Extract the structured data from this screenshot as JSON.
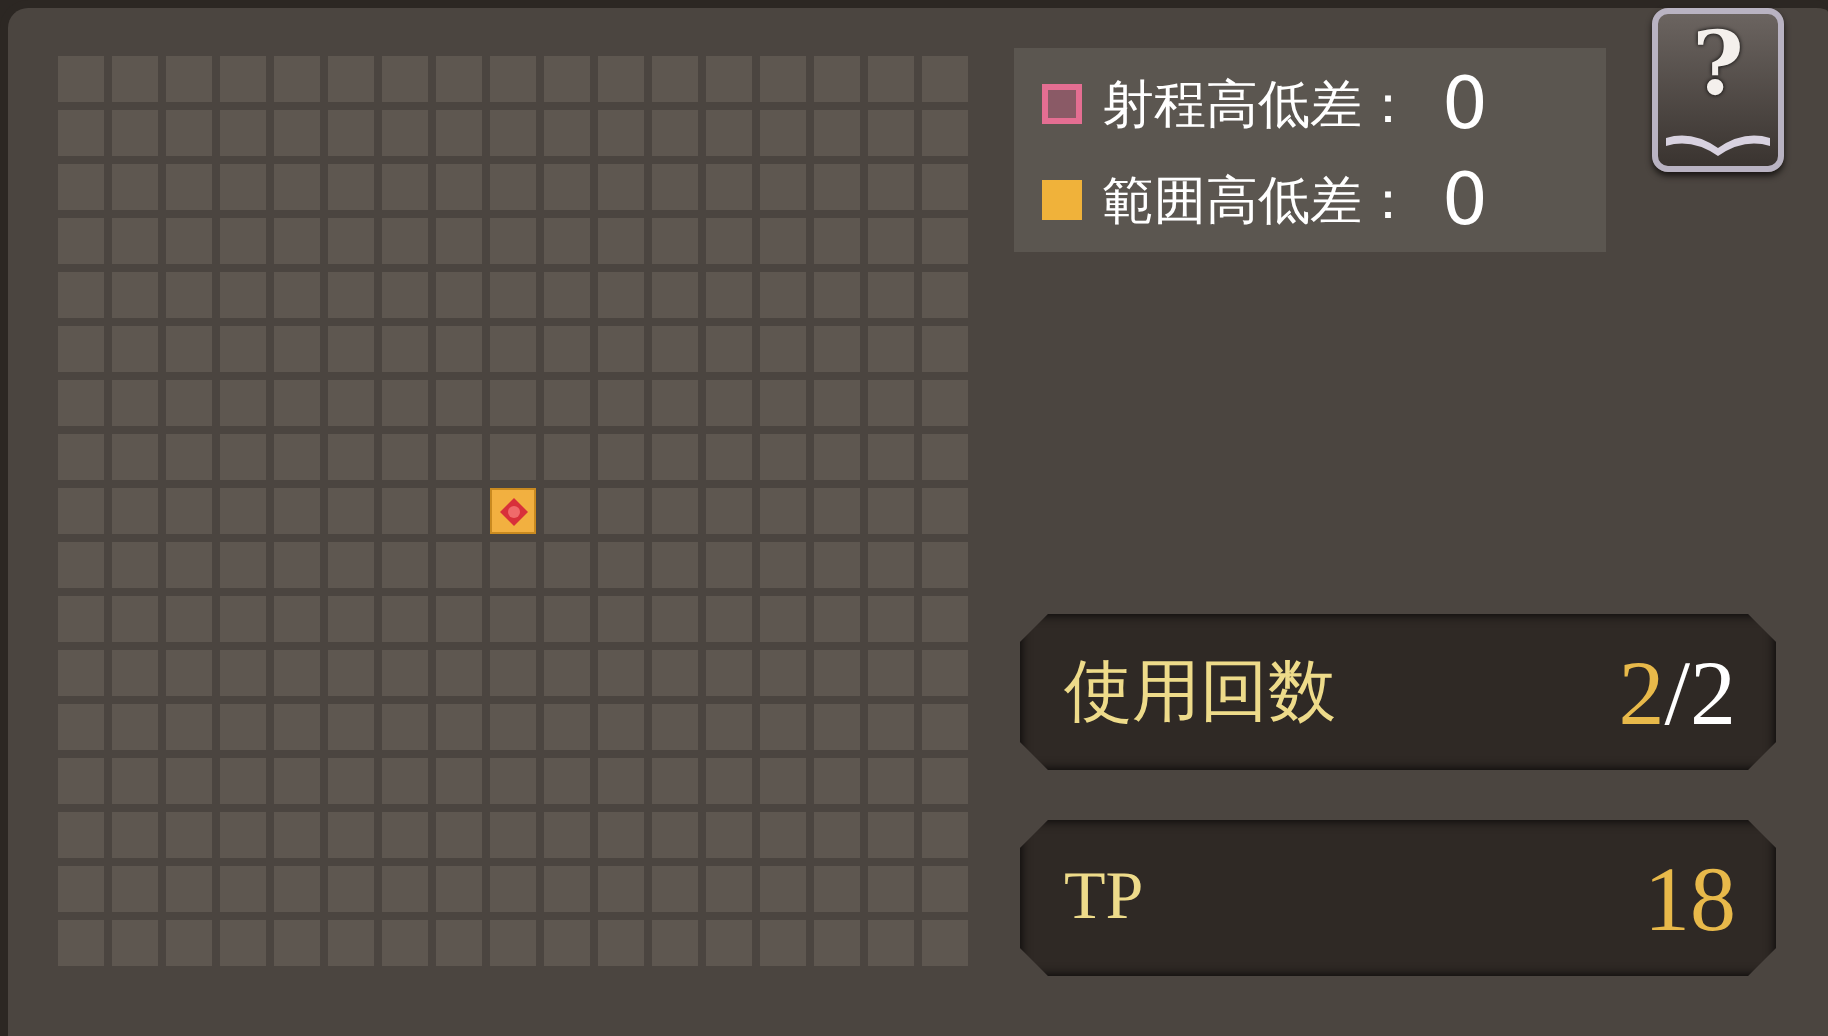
{
  "grid": {
    "rows": [
      [
        {
          "kind": "empty"
        },
        {
          "kind": "empty"
        },
        {
          "kind": "empty"
        },
        {
          "kind": "empty"
        },
        {
          "kind": "empty"
        },
        {
          "kind": "empty"
        },
        {
          "kind": "empty"
        },
        {
          "kind": "empty"
        },
        {
          "kind": "empty"
        },
        {
          "kind": "empty"
        },
        {
          "kind": "empty"
        },
        {
          "kind": "empty"
        },
        {
          "kind": "empty"
        },
        {
          "kind": "empty"
        },
        {
          "kind": "empty"
        },
        {
          "kind": "empty"
        },
        {
          "kind": "empty"
        }
      ],
      [
        {
          "kind": "empty"
        },
        {
          "kind": "empty"
        },
        {
          "kind": "empty"
        },
        {
          "kind": "empty"
        },
        {
          "kind": "empty"
        },
        {
          "kind": "empty"
        },
        {
          "kind": "empty"
        },
        {
          "kind": "empty"
        },
        {
          "kind": "empty"
        },
        {
          "kind": "empty"
        },
        {
          "kind": "empty"
        },
        {
          "kind": "empty"
        },
        {
          "kind": "empty"
        },
        {
          "kind": "empty"
        },
        {
          "kind": "empty"
        },
        {
          "kind": "empty"
        },
        {
          "kind": "empty"
        }
      ],
      [
        {
          "kind": "empty"
        },
        {
          "kind": "empty"
        },
        {
          "kind": "empty"
        },
        {
          "kind": "empty"
        },
        {
          "kind": "empty"
        },
        {
          "kind": "empty"
        },
        {
          "kind": "empty"
        },
        {
          "kind": "empty"
        },
        {
          "kind": "empty"
        },
        {
          "kind": "empty"
        },
        {
          "kind": "empty"
        },
        {
          "kind": "empty"
        },
        {
          "kind": "empty"
        },
        {
          "kind": "empty"
        },
        {
          "kind": "empty"
        },
        {
          "kind": "empty"
        },
        {
          "kind": "empty"
        }
      ],
      [
        {
          "kind": "empty"
        },
        {
          "kind": "empty"
        },
        {
          "kind": "empty"
        },
        {
          "kind": "empty"
        },
        {
          "kind": "empty"
        },
        {
          "kind": "empty"
        },
        {
          "kind": "empty"
        },
        {
          "kind": "empty"
        },
        {
          "kind": "empty"
        },
        {
          "kind": "empty"
        },
        {
          "kind": "empty"
        },
        {
          "kind": "empty"
        },
        {
          "kind": "empty"
        },
        {
          "kind": "empty"
        },
        {
          "kind": "empty"
        },
        {
          "kind": "empty"
        },
        {
          "kind": "empty"
        }
      ],
      [
        {
          "kind": "empty"
        },
        {
          "kind": "empty"
        },
        {
          "kind": "empty"
        },
        {
          "kind": "empty"
        },
        {
          "kind": "empty"
        },
        {
          "kind": "empty"
        },
        {
          "kind": "empty"
        },
        {
          "kind": "empty"
        },
        {
          "kind": "empty"
        },
        {
          "kind": "empty"
        },
        {
          "kind": "empty"
        },
        {
          "kind": "empty"
        },
        {
          "kind": "empty"
        },
        {
          "kind": "empty"
        },
        {
          "kind": "empty"
        },
        {
          "kind": "empty"
        },
        {
          "kind": "empty"
        }
      ],
      [
        {
          "kind": "empty"
        },
        {
          "kind": "empty"
        },
        {
          "kind": "empty"
        },
        {
          "kind": "empty"
        },
        {
          "kind": "empty"
        },
        {
          "kind": "empty"
        },
        {
          "kind": "empty"
        },
        {
          "kind": "empty"
        },
        {
          "kind": "empty"
        },
        {
          "kind": "empty"
        },
        {
          "kind": "empty"
        },
        {
          "kind": "empty"
        },
        {
          "kind": "empty"
        },
        {
          "kind": "empty"
        },
        {
          "kind": "empty"
        },
        {
          "kind": "empty"
        },
        {
          "kind": "empty"
        }
      ],
      [
        {
          "kind": "empty"
        },
        {
          "kind": "empty"
        },
        {
          "kind": "empty"
        },
        {
          "kind": "empty"
        },
        {
          "kind": "empty"
        },
        {
          "kind": "empty"
        },
        {
          "kind": "empty"
        },
        {
          "kind": "empty"
        },
        {
          "kind": "empty"
        },
        {
          "kind": "empty"
        },
        {
          "kind": "empty"
        },
        {
          "kind": "empty"
        },
        {
          "kind": "empty"
        },
        {
          "kind": "empty"
        },
        {
          "kind": "empty"
        },
        {
          "kind": "empty"
        },
        {
          "kind": "empty"
        }
      ],
      [
        {
          "kind": "empty"
        },
        {
          "kind": "empty"
        },
        {
          "kind": "empty"
        },
        {
          "kind": "empty"
        },
        {
          "kind": "empty"
        },
        {
          "kind": "empty"
        },
        {
          "kind": "empty"
        },
        {
          "kind": "empty"
        },
        {
          "kind": "empty"
        },
        {
          "kind": "empty"
        },
        {
          "kind": "empty"
        },
        {
          "kind": "empty"
        },
        {
          "kind": "empty"
        },
        {
          "kind": "empty"
        },
        {
          "kind": "empty"
        },
        {
          "kind": "empty"
        },
        {
          "kind": "empty"
        }
      ],
      [
        {
          "kind": "empty"
        },
        {
          "kind": "empty"
        },
        {
          "kind": "empty"
        },
        {
          "kind": "empty"
        },
        {
          "kind": "empty"
        },
        {
          "kind": "empty"
        },
        {
          "kind": "empty"
        },
        {
          "kind": "empty"
        },
        {
          "kind": "origin"
        },
        {
          "kind": "empty"
        },
        {
          "kind": "empty"
        },
        {
          "kind": "empty"
        },
        {
          "kind": "empty"
        },
        {
          "kind": "empty"
        },
        {
          "kind": "empty"
        },
        {
          "kind": "empty"
        },
        {
          "kind": "empty"
        }
      ],
      [
        {
          "kind": "empty"
        },
        {
          "kind": "empty"
        },
        {
          "kind": "empty"
        },
        {
          "kind": "empty"
        },
        {
          "kind": "empty"
        },
        {
          "kind": "empty"
        },
        {
          "kind": "empty"
        },
        {
          "kind": "empty"
        },
        {
          "kind": "empty"
        },
        {
          "kind": "empty"
        },
        {
          "kind": "empty"
        },
        {
          "kind": "empty"
        },
        {
          "kind": "empty"
        },
        {
          "kind": "empty"
        },
        {
          "kind": "empty"
        },
        {
          "kind": "empty"
        },
        {
          "kind": "empty"
        }
      ],
      [
        {
          "kind": "empty"
        },
        {
          "kind": "empty"
        },
        {
          "kind": "empty"
        },
        {
          "kind": "empty"
        },
        {
          "kind": "empty"
        },
        {
          "kind": "empty"
        },
        {
          "kind": "empty"
        },
        {
          "kind": "empty"
        },
        {
          "kind": "empty"
        },
        {
          "kind": "empty"
        },
        {
          "kind": "empty"
        },
        {
          "kind": "empty"
        },
        {
          "kind": "empty"
        },
        {
          "kind": "empty"
        },
        {
          "kind": "empty"
        },
        {
          "kind": "empty"
        },
        {
          "kind": "empty"
        }
      ],
      [
        {
          "kind": "empty"
        },
        {
          "kind": "empty"
        },
        {
          "kind": "empty"
        },
        {
          "kind": "empty"
        },
        {
          "kind": "empty"
        },
        {
          "kind": "empty"
        },
        {
          "kind": "empty"
        },
        {
          "kind": "empty"
        },
        {
          "kind": "empty"
        },
        {
          "kind": "empty"
        },
        {
          "kind": "empty"
        },
        {
          "kind": "empty"
        },
        {
          "kind": "empty"
        },
        {
          "kind": "empty"
        },
        {
          "kind": "empty"
        },
        {
          "kind": "empty"
        },
        {
          "kind": "empty"
        }
      ],
      [
        {
          "kind": "empty"
        },
        {
          "kind": "empty"
        },
        {
          "kind": "empty"
        },
        {
          "kind": "empty"
        },
        {
          "kind": "empty"
        },
        {
          "kind": "empty"
        },
        {
          "kind": "empty"
        },
        {
          "kind": "empty"
        },
        {
          "kind": "empty"
        },
        {
          "kind": "empty"
        },
        {
          "kind": "empty"
        },
        {
          "kind": "empty"
        },
        {
          "kind": "empty"
        },
        {
          "kind": "empty"
        },
        {
          "kind": "empty"
        },
        {
          "kind": "empty"
        },
        {
          "kind": "empty"
        }
      ],
      [
        {
          "kind": "empty"
        },
        {
          "kind": "empty"
        },
        {
          "kind": "empty"
        },
        {
          "kind": "empty"
        },
        {
          "kind": "empty"
        },
        {
          "kind": "empty"
        },
        {
          "kind": "empty"
        },
        {
          "kind": "empty"
        },
        {
          "kind": "empty"
        },
        {
          "kind": "empty"
        },
        {
          "kind": "empty"
        },
        {
          "kind": "empty"
        },
        {
          "kind": "empty"
        },
        {
          "kind": "empty"
        },
        {
          "kind": "empty"
        },
        {
          "kind": "empty"
        },
        {
          "kind": "empty"
        }
      ],
      [
        {
          "kind": "empty"
        },
        {
          "kind": "empty"
        },
        {
          "kind": "empty"
        },
        {
          "kind": "empty"
        },
        {
          "kind": "empty"
        },
        {
          "kind": "empty"
        },
        {
          "kind": "empty"
        },
        {
          "kind": "empty"
        },
        {
          "kind": "empty"
        },
        {
          "kind": "empty"
        },
        {
          "kind": "empty"
        },
        {
          "kind": "empty"
        },
        {
          "kind": "empty"
        },
        {
          "kind": "empty"
        },
        {
          "kind": "empty"
        },
        {
          "kind": "empty"
        },
        {
          "kind": "empty"
        }
      ],
      [
        {
          "kind": "empty"
        },
        {
          "kind": "empty"
        },
        {
          "kind": "empty"
        },
        {
          "kind": "empty"
        },
        {
          "kind": "empty"
        },
        {
          "kind": "empty"
        },
        {
          "kind": "empty"
        },
        {
          "kind": "empty"
        },
        {
          "kind": "empty"
        },
        {
          "kind": "empty"
        },
        {
          "kind": "empty"
        },
        {
          "kind": "empty"
        },
        {
          "kind": "empty"
        },
        {
          "kind": "empty"
        },
        {
          "kind": "empty"
        },
        {
          "kind": "empty"
        },
        {
          "kind": "empty"
        }
      ],
      [
        {
          "kind": "empty"
        },
        {
          "kind": "empty"
        },
        {
          "kind": "empty"
        },
        {
          "kind": "empty"
        },
        {
          "kind": "empty"
        },
        {
          "kind": "empty"
        },
        {
          "kind": "empty"
        },
        {
          "kind": "empty"
        },
        {
          "kind": "empty"
        },
        {
          "kind": "empty"
        },
        {
          "kind": "empty"
        },
        {
          "kind": "empty"
        },
        {
          "kind": "empty"
        },
        {
          "kind": "empty"
        },
        {
          "kind": "empty"
        },
        {
          "kind": "empty"
        },
        {
          "kind": "empty"
        }
      ]
    ]
  },
  "legend": [
    {
      "kind": "outline",
      "color": "#e46e92",
      "label": "射程高低差：",
      "value": "0"
    },
    {
      "kind": "filled",
      "color": "#f0b23a",
      "label": "範囲高低差：",
      "value": "0"
    }
  ],
  "help_button": {
    "glyph": "?"
  },
  "stats": [
    {
      "label": "使用回数",
      "value": "2",
      "separator": "/",
      "max": "2"
    },
    {
      "label": "TP",
      "value": "18"
    }
  ]
}
